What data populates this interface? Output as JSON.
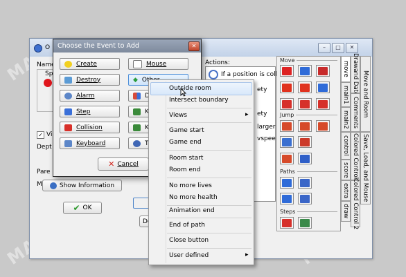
{
  "object_window": {
    "title_initial": "O",
    "labels": {
      "name": "Name",
      "sprite": "Sp",
      "visible": "Vi",
      "depth": "Dept",
      "parent": "Pare",
      "mask": "Mask"
    },
    "show_information": "Show Information",
    "ok": "OK",
    "actions_title": "Actions:",
    "action_line1": "If a position is colli",
    "action_partials": [
      "ety",
      "ety",
      "larger",
      "vspee"
    ],
    "de_button": "De",
    "title_buttons": [
      "–",
      "□",
      "✕"
    ]
  },
  "action_library": {
    "groups": [
      "Move",
      "Jump",
      "Paths",
      "Steps"
    ],
    "tabs_left": [
      "move",
      "main1",
      "main2",
      "control",
      "score",
      "extra",
      "draw"
    ],
    "tabs_right": [
      "Move and Room",
      "Drawand Date",
      "Comments",
      "Colored Control",
      "Save, Load, and Mouse",
      "Colored Control 2"
    ]
  },
  "event_dialog": {
    "title": "Choose the Event to Add",
    "close": "✕",
    "buttons": [
      {
        "label": "Create",
        "icon": "bulb-icon",
        "color": "#f2d020"
      },
      {
        "label": "Mouse",
        "icon": "mouse-icon",
        "color": "#ffffff"
      },
      {
        "label": "Destroy",
        "icon": "trash-icon",
        "color": "#5b9bd5"
      },
      {
        "label": "Other",
        "icon": "arrow-icon",
        "color": "#2a9d3e"
      },
      {
        "label": "Alarm",
        "icon": "clock-icon",
        "color": "#5c86c8"
      },
      {
        "label": "D",
        "icon": "draw-icon",
        "color": "#d84a3a"
      },
      {
        "label": "Step",
        "icon": "steps-icon",
        "color": "#3a6fd8"
      },
      {
        "label": "K",
        "icon": "key-icon",
        "color": "#3a8a3a"
      },
      {
        "label": "Collision",
        "icon": "collision-icon",
        "color": "#d8302a"
      },
      {
        "label": "K",
        "icon": "keyboard-press-icon",
        "color": "#3a8a3a"
      },
      {
        "label": "Keyboard",
        "icon": "keyboard-icon",
        "color": "#5c86c8"
      },
      {
        "label": "T",
        "icon": "trigger-icon",
        "color": "#3f66b5"
      }
    ],
    "cancel": "Cancel"
  },
  "context_menu": {
    "items": [
      {
        "label": "Outside room",
        "submenu": false
      },
      {
        "label": "Intersect boundary",
        "submenu": false
      },
      {
        "label": "Views",
        "submenu": true
      },
      {
        "label": "Game start",
        "submenu": false
      },
      {
        "label": "Game end",
        "submenu": false
      },
      {
        "label": "Room start",
        "submenu": false
      },
      {
        "label": "Room end",
        "submenu": false
      },
      {
        "label": "No more lives",
        "submenu": false
      },
      {
        "label": "No more health",
        "submenu": false
      },
      {
        "label": "Animation end",
        "submenu": false
      },
      {
        "label": "End of path",
        "submenu": false
      },
      {
        "label": "Close button",
        "submenu": false
      },
      {
        "label": "User defined",
        "submenu": true
      }
    ],
    "submenu_arrow": "▸"
  },
  "watermark": "MAKE"
}
